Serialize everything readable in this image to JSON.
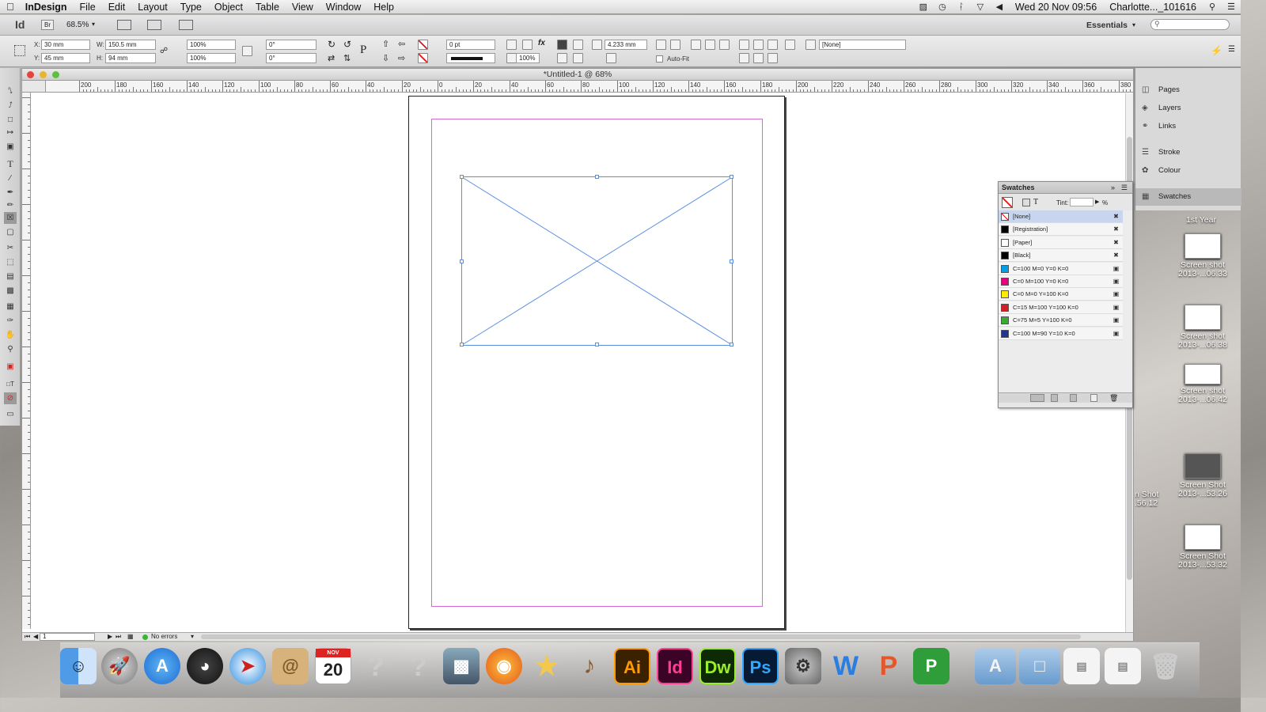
{
  "menubar": {
    "apple": "",
    "app": "InDesign",
    "items": [
      "File",
      "Edit",
      "Layout",
      "Type",
      "Object",
      "Table",
      "View",
      "Window",
      "Help"
    ],
    "clock": "Wed 20 Nov  09:56",
    "user": "Charlotte..._101616"
  },
  "appbar": {
    "logo": "Id",
    "bridge": "Br",
    "zoom": "68.5%",
    "workspace": "Essentials",
    "search_placeholder": ""
  },
  "control": {
    "x_label": "X:",
    "x_value": "30 mm",
    "y_label": "Y:",
    "y_value": "45 mm",
    "w_label": "W:",
    "w_value": "150.5 mm",
    "h_label": "H:",
    "h_value": "94 mm",
    "scale_x": "100%",
    "scale_y": "100%",
    "rotate": "0°",
    "shear": "0°",
    "stroke_weight": "0 pt",
    "opacity": "100%",
    "dimension": "4.233 mm",
    "autofit": "Auto-Fit",
    "style": "[None]"
  },
  "document": {
    "title": "*Untitled-1 @ 68%",
    "ruler_labels": [
      "200",
      "180",
      "160",
      "140",
      "120",
      "100",
      "80",
      "60",
      "40",
      "20",
      "0",
      "20",
      "40",
      "60",
      "80",
      "100",
      "120",
      "140",
      "160",
      "180",
      "200",
      "220",
      "240",
      "260",
      "280",
      "300",
      "320",
      "340",
      "360",
      "380"
    ],
    "page_number": "1",
    "preflight": "No errors"
  },
  "dock_panel": {
    "items": [
      "Pages",
      "Layers",
      "Links",
      "Stroke",
      "Colour",
      "Swatches"
    ]
  },
  "swatches": {
    "title": "Swatches",
    "tint_label": "Tint:",
    "tint_unit": "%",
    "rows": [
      {
        "name": "[None]",
        "color": "#ffffff"
      },
      {
        "name": "[Registration]",
        "color": "#000000"
      },
      {
        "name": "[Paper]",
        "color": "#ffffff"
      },
      {
        "name": "[Black]",
        "color": "#000000"
      },
      {
        "name": "C=100 M=0 Y=0 K=0",
        "color": "#00a0e3"
      },
      {
        "name": "C=0 M=100 Y=0 K=0",
        "color": "#e6007e"
      },
      {
        "name": "C=0 M=0 Y=100 K=0",
        "color": "#ffed00"
      },
      {
        "name": "C=15 M=100 Y=100 K=0",
        "color": "#d51f26"
      },
      {
        "name": "C=75 M=5 Y=100 K=0",
        "color": "#3aa935"
      },
      {
        "name": "C=100 M=90 Y=10 K=0",
        "color": "#22368a"
      }
    ]
  },
  "desktop": {
    "items": [
      {
        "label": "1st Year"
      },
      {
        "label": "Screen shot\n2013-...06.33"
      },
      {
        "label": "Screen shot\n2013-...06.38"
      },
      {
        "label": "Screen shot\n2013-...06.42"
      },
      {
        "label": "Screen Shot\n2013-...53.26"
      },
      {
        "label": "Screen Shot\n2013-...53.32"
      }
    ],
    "partial_label": "n Shot\n.56.12"
  },
  "dock": {
    "calendar_month": "NOV",
    "calendar_day": "20",
    "apps": [
      "Ai",
      "Id",
      "Dw",
      "Ps",
      "W",
      "P",
      "P"
    ]
  }
}
